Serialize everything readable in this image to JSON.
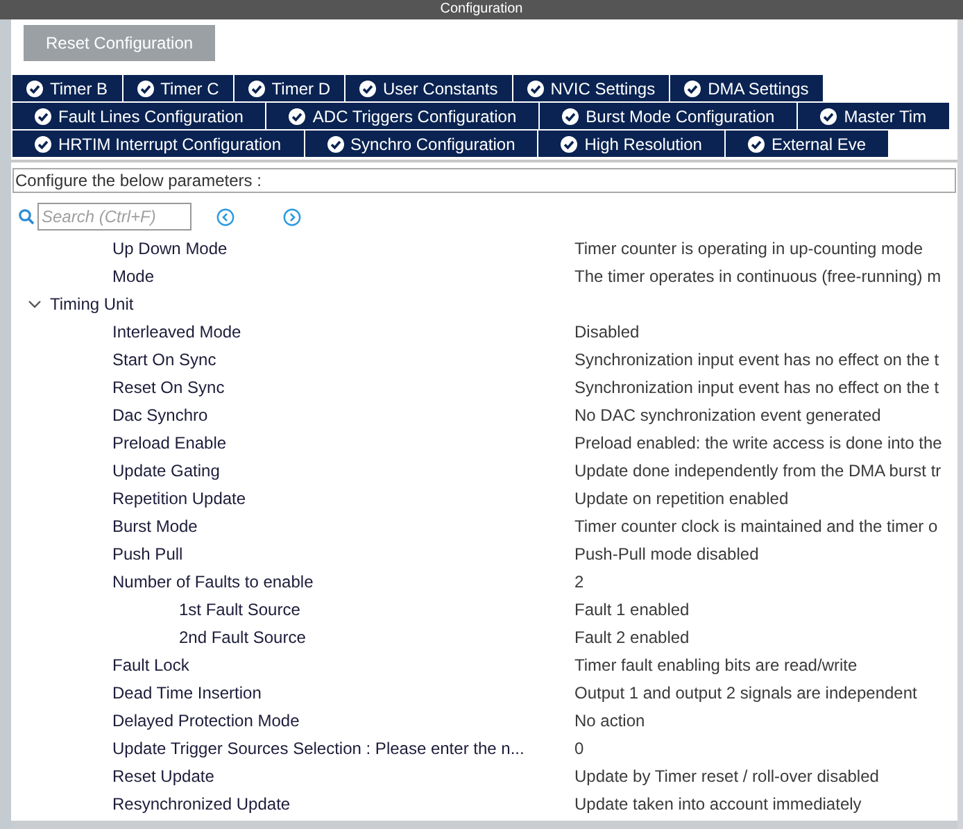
{
  "window": {
    "title": "Configuration"
  },
  "reset_button": "Reset Configuration",
  "tab_rows": [
    [
      {
        "label": "Timer B",
        "checked": true
      },
      {
        "label": "Timer C",
        "checked": true
      },
      {
        "label": "Timer D",
        "checked": true
      },
      {
        "label": "User Constants",
        "checked": true
      },
      {
        "label": "NVIC Settings",
        "checked": true
      },
      {
        "label": "DMA Settings",
        "checked": true
      }
    ],
    [
      {
        "label": "Fault Lines Configuration",
        "checked": true
      },
      {
        "label": "ADC Triggers Configuration",
        "checked": true
      },
      {
        "label": "Burst Mode Configuration",
        "checked": true
      },
      {
        "label": "Master Tim",
        "checked": true
      }
    ],
    [
      {
        "label": "HRTIM Interrupt Configuration",
        "checked": true
      },
      {
        "label": "Synchro Configuration",
        "checked": true
      },
      {
        "label": "High Resolution",
        "checked": true
      },
      {
        "label": "External Eve",
        "checked": true
      }
    ]
  ],
  "instructions": "Configure the below parameters :",
  "search": {
    "placeholder": "Search (Ctrl+F)"
  },
  "tree": [
    {
      "kind": "param",
      "name": "Up Down Mode",
      "value": "Timer counter is operating in up-counting mode"
    },
    {
      "kind": "param",
      "name": "Mode",
      "value": "The timer operates in continuous (free-running) m"
    },
    {
      "kind": "group",
      "name": "Timing Unit",
      "expanded": true,
      "children": [
        {
          "kind": "param",
          "name": "Interleaved Mode",
          "value": "Disabled"
        },
        {
          "kind": "param",
          "name": "Start On Sync",
          "value": "Synchronization input event has no effect on the t"
        },
        {
          "kind": "param",
          "name": "Reset On Sync",
          "value": "Synchronization input event has no effect on the t"
        },
        {
          "kind": "param",
          "name": "Dac Synchro",
          "value": "No DAC synchronization event generated"
        },
        {
          "kind": "param",
          "name": "Preload Enable",
          "value": "Preload enabled: the write access is done into the"
        },
        {
          "kind": "param",
          "name": "Update Gating",
          "value": "Update done independently from the DMA burst tr"
        },
        {
          "kind": "param",
          "name": "Repetition Update",
          "value": "Update on repetition enabled"
        },
        {
          "kind": "param",
          "name": "Burst Mode",
          "value": "Timer counter clock is maintained and the timer o"
        },
        {
          "kind": "param",
          "name": "Push Pull",
          "value": "Push-Pull mode disabled"
        },
        {
          "kind": "param",
          "name": "Number of Faults to enable",
          "value": "2",
          "children": [
            {
              "kind": "param",
              "name": "1st Fault Source",
              "value": "Fault 1 enabled"
            },
            {
              "kind": "param",
              "name": "2nd Fault Source",
              "value": "Fault 2 enabled"
            }
          ]
        },
        {
          "kind": "param",
          "name": "Fault Lock",
          "value": "Timer fault enabling bits are read/write"
        },
        {
          "kind": "param",
          "name": "Dead Time Insertion",
          "value": "Output 1 and output 2 signals are independent"
        },
        {
          "kind": "param",
          "name": "Delayed Protection Mode",
          "value": "No action"
        },
        {
          "kind": "param",
          "name": "Update Trigger Sources Selection : Please enter the n...",
          "value": "0"
        },
        {
          "kind": "param",
          "name": "Reset Update",
          "value": "Update by Timer reset / roll-over disabled"
        },
        {
          "kind": "param",
          "name": "Resynchronized Update",
          "value": "Update taken into account immediately"
        }
      ]
    }
  ]
}
